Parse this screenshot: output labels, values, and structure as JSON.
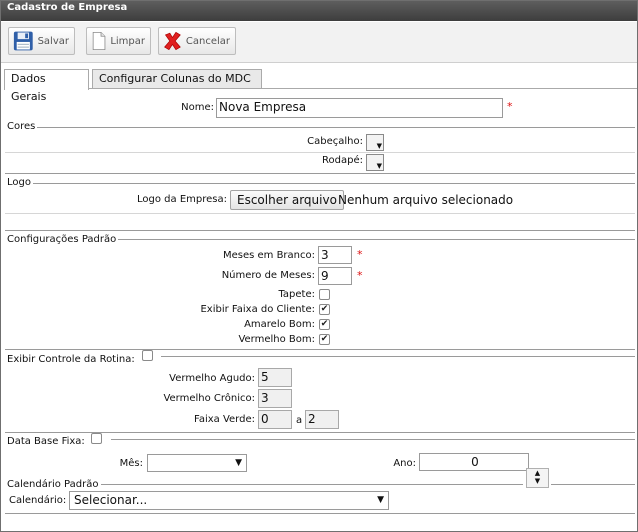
{
  "window": {
    "title": "Cadastro de Empresa"
  },
  "toolbar": {
    "save_label": "Salvar",
    "clear_label": "Limpar",
    "cancel_label": "Cancelar"
  },
  "tabs": [
    {
      "label": "Dados Gerais",
      "active": true
    },
    {
      "label": "Configurar Colunas do MDC",
      "active": false
    }
  ],
  "form": {
    "name_label": "Nome:",
    "name_value": "Nova Empresa",
    "required_mark": "*",
    "cores": {
      "legend": "Cores",
      "header_label": "Cabeçalho:",
      "footer_label": "Rodapé:"
    },
    "logo": {
      "legend": "Logo",
      "label": "Logo da Empresa:",
      "button": "Escolher arquivo",
      "status": "Nenhum arquivo selecionado"
    },
    "config": {
      "legend": "Configurações Padrão",
      "meses_branco_label": "Meses em Branco:",
      "meses_branco_value": "3",
      "num_meses_label": "Número de Meses:",
      "num_meses_value": "9",
      "tapete_label": "Tapete:",
      "tapete_checked": false,
      "faixa_label": "Exibir Faixa do Cliente:",
      "faixa_checked": true,
      "amarelo_label": "Amarelo Bom:",
      "amarelo_checked": true,
      "vermelho_label": "Vermelho Bom:",
      "vermelho_checked": true
    },
    "rotina": {
      "legend": "Exibir Controle da Rotina:",
      "agudo_label": "Vermelho Agudo:",
      "agudo_value": "5",
      "cronico_label": "Vermelho Crônico:",
      "cronico_value": "3",
      "verde_label": "Faixa Verde:",
      "verde_from": "0",
      "verde_sep": "a",
      "verde_to": "2"
    },
    "database": {
      "legend": "Data Base Fixa:",
      "mes_label": "Mês:",
      "mes_value": "",
      "ano_label": "Ano:",
      "ano_value": "0"
    },
    "calendario": {
      "legend": "Calendário Padrão",
      "label": "Calendário:",
      "value": "Selecionar..."
    }
  },
  "icons": {
    "save": "floppy-disk-icon",
    "clear": "blank-page-icon",
    "cancel": "red-x-icon",
    "dropdown": "triangle-down-icon",
    "check": "checkmark-icon"
  }
}
